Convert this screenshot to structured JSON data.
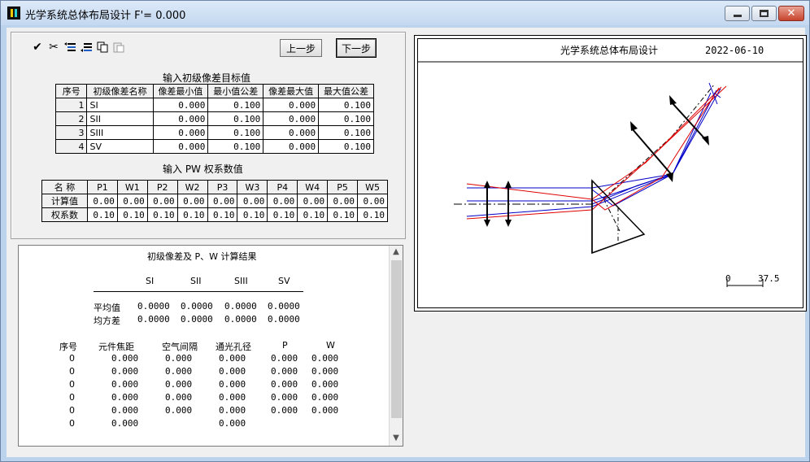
{
  "window": {
    "title": "光学系统总体布局设计    F'= 0.000",
    "min_icon": "minimize-icon",
    "max_icon": "maximize-icon",
    "close_icon": "close-icon",
    "close_glyph": "✕"
  },
  "toolbar": {
    "check_glyph": "✔",
    "cut_glyph": "✂",
    "prev_label": "上一步",
    "next_label": "下一步"
  },
  "aberration_targets": {
    "caption": "输入初级像差目标值",
    "headers": [
      "序号",
      "初级像差名称",
      "像差最小值",
      "最小值公差",
      "像差最大值",
      "最大值公差"
    ],
    "rows": [
      {
        "no": "1",
        "name": "SI",
        "min": "0.000",
        "min_tol": "0.100",
        "max": "0.000",
        "max_tol": "0.100"
      },
      {
        "no": "2",
        "name": "SII",
        "min": "0.000",
        "min_tol": "0.100",
        "max": "0.000",
        "max_tol": "0.100"
      },
      {
        "no": "3",
        "name": "SIII",
        "min": "0.000",
        "min_tol": "0.100",
        "max": "0.000",
        "max_tol": "0.100"
      },
      {
        "no": "4",
        "name": "SV",
        "min": "0.000",
        "min_tol": "0.100",
        "max": "0.000",
        "max_tol": "0.100"
      }
    ]
  },
  "pw_weights": {
    "caption": "输入 PW 权系数值",
    "headers": [
      "名 称",
      "P1",
      "W1",
      "P2",
      "W2",
      "P3",
      "W3",
      "P4",
      "W4",
      "P5",
      "W5"
    ],
    "computed_label": "计算值",
    "computed": [
      "0.00",
      "0.00",
      "0.00",
      "0.00",
      "0.00",
      "0.00",
      "0.00",
      "0.00",
      "0.00",
      "0.00"
    ],
    "weight_label": "权系数",
    "weights": [
      "0.10",
      "0.10",
      "0.10",
      "0.10",
      "0.10",
      "0.10",
      "0.10",
      "0.10",
      "0.10",
      "0.10"
    ]
  },
  "results": {
    "title": "初级像差及 P、W 计算结果",
    "col_headers": [
      "SI",
      "SII",
      "SIII",
      "SV"
    ],
    "mean_label": "平均值",
    "mean": [
      "0.0000",
      "0.0000",
      "0.0000",
      "0.0000"
    ],
    "msd_label": "均方差",
    "msd": [
      "0.0000",
      "0.0000",
      "0.0000",
      "0.0000"
    ],
    "element_headers": [
      "序号",
      "元件焦距",
      "空气间隔",
      "通光孔径",
      "P",
      "W"
    ],
    "elements": [
      [
        "0",
        "0.000",
        "0.000",
        "0.000",
        "0.000",
        "0.000"
      ],
      [
        "0",
        "0.000",
        "0.000",
        "0.000",
        "0.000",
        "0.000"
      ],
      [
        "0",
        "0.000",
        "0.000",
        "0.000",
        "0.000",
        "0.000"
      ],
      [
        "0",
        "0.000",
        "0.000",
        "0.000",
        "0.000",
        "0.000"
      ],
      [
        "0",
        "0.000",
        "0.000",
        "0.000",
        "0.000",
        "0.000"
      ],
      [
        "0",
        "0.000",
        "",
        "0.000",
        "",
        ""
      ]
    ],
    "scroll_up": "▲",
    "scroll_down": "▼"
  },
  "drawing": {
    "title": "光学系统总体布局设计",
    "date": "2022-06-10",
    "scale_start": "0",
    "scale_end": "37.5",
    "colors": {
      "red": "#e00000",
      "blue": "#0000c8",
      "black": "#000000"
    }
  }
}
